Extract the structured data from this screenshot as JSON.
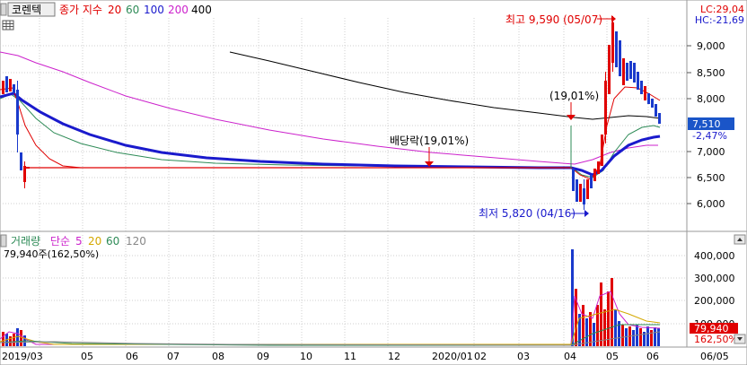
{
  "header": {
    "stock_name": "코렌텍",
    "ma_label": "종가 지수",
    "ma_periods": [
      "20",
      "60",
      "100",
      "200",
      "400"
    ],
    "ma_colors": [
      "#e00000",
      "#2e8b57",
      "#1a1acc",
      "#cc22cc",
      "#000000"
    ]
  },
  "info": {
    "lc_label": "LC:29,04",
    "hc_label": "HC:-21,69"
  },
  "current": {
    "price_label": "7,510",
    "change_label": "-2,47%",
    "volume_label": "79,940",
    "volume_change_label": "162,50%"
  },
  "volume_header": {
    "title": "거래량",
    "ma_label": "단순",
    "ma_periods": [
      "5",
      "20",
      "60",
      "120"
    ],
    "ma_colors": [
      "#cc22cc",
      "#d4a800",
      "#2e8b57",
      "#888888"
    ],
    "value_label": "79,940주(162,50%)"
  },
  "annotations": {
    "high": "최고 9,590 (05/07)",
    "low": "최저 5,820 (04/16)",
    "dividend_1": "배당락(19,01%)",
    "dividend_2": "(19,01%)"
  },
  "colors": {
    "up": "#e00000",
    "down": "#1a3acc",
    "price_box": "#1a55c8",
    "volume_box": "#e00000",
    "grid": "#c8c8c8"
  },
  "chart_data": [
    {
      "type": "candlestick",
      "title": "코렌텍",
      "ylim": [
        5700,
        9800
      ],
      "y_ticks": [
        "6,000",
        "6,500",
        "7,000",
        "7,500",
        "8,000",
        "8,500",
        "9,000"
      ],
      "x_ticks": [
        "2019/03",
        "05",
        "06",
        "07",
        "08",
        "09",
        "10",
        "11",
        "12",
        "2020/01",
        "02",
        "03",
        "04",
        "05",
        "06",
        "06/05"
      ],
      "annotations": [
        {
          "text": "최고 9,590 (05/07)",
          "date": "2020/05/07",
          "value": 9590
        },
        {
          "text": "최저 5,820 (04/16)",
          "date": "2020/04/16",
          "value": 5820
        },
        {
          "text": "배당락(19,01%)",
          "date": "2019/12",
          "value": 6700
        },
        {
          "text": "(19,01%)",
          "date": "2020/04",
          "value": 7700
        }
      ],
      "series": [
        {
          "name": "20",
          "color": "#e00000",
          "values": [
            8000,
            7000,
            6750,
            6700,
            6700,
            6700,
            6700,
            6700,
            6700,
            6700,
            6700,
            6700,
            6650,
            8700,
            7900
          ]
        },
        {
          "name": "60",
          "color": "#2e8b57",
          "values": [
            7950,
            7300,
            7000,
            6900,
            6850,
            6800,
            6780,
            6760,
            6750,
            6740,
            6720,
            6700,
            6600,
            7300,
            7550
          ]
        },
        {
          "name": "100",
          "color": "#1a1acc",
          "values": [
            8100,
            7700,
            7400,
            7150,
            7000,
            6920,
            6850,
            6800,
            6760,
            6720,
            6700,
            6680,
            6600,
            7000,
            7270
          ]
        },
        {
          "name": "200",
          "color": "#cc22cc",
          "values": [
            8850,
            8550,
            8250,
            7950,
            7750,
            7550,
            7400,
            7300,
            7200,
            7100,
            7000,
            6950,
            6900,
            6950,
            7100
          ]
        },
        {
          "name": "400",
          "color": "#000000",
          "values": [
            null,
            null,
            null,
            null,
            8900,
            8700,
            8500,
            8350,
            8200,
            8050,
            7900,
            7800,
            7700,
            7600,
            7650
          ]
        }
      ]
    },
    {
      "type": "bar",
      "title": "거래량",
      "ylim": [
        0,
        450000
      ],
      "y_ticks": [
        "100,000",
        "200,000",
        "300,000",
        "400,000"
      ],
      "x_ticks": [
        "2019/03",
        "05",
        "06",
        "07",
        "08",
        "09",
        "10",
        "11",
        "12",
        "2020/01",
        "02",
        "03",
        "04",
        "05",
        "06",
        "06/05"
      ],
      "categories": [
        "2019/03",
        "05",
        "06",
        "07",
        "08",
        "09",
        "10",
        "11",
        "12",
        "2020/01",
        "02",
        "03",
        "04",
        "05",
        "06"
      ],
      "max_value": 440000,
      "last_value": 79940
    }
  ]
}
